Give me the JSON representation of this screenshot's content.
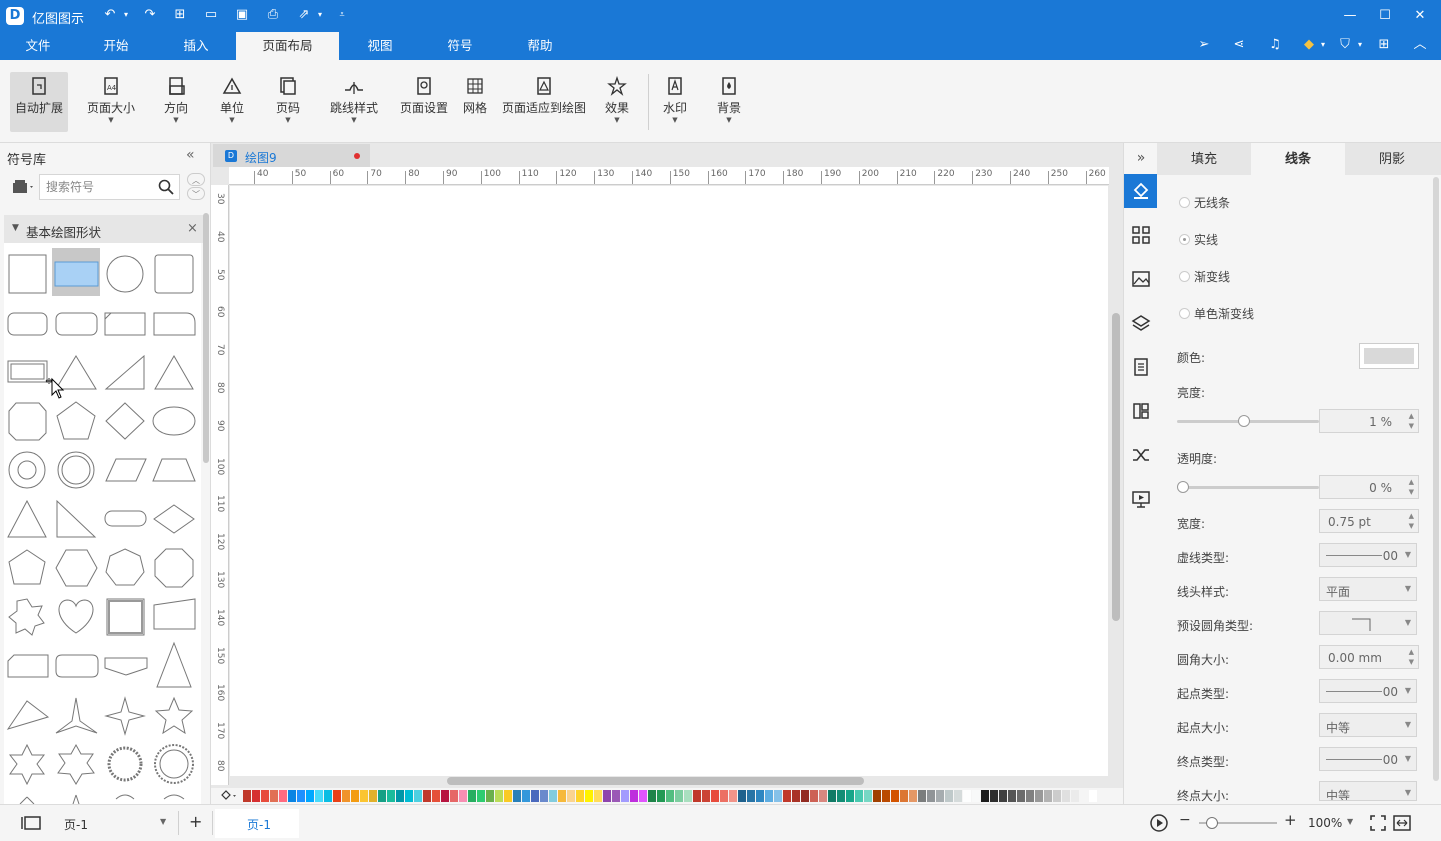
{
  "app": {
    "name": "亿图图示",
    "brand_color": "#1a78d6"
  },
  "menu": {
    "items": [
      "文件",
      "开始",
      "插入",
      "页面布局",
      "视图",
      "符号",
      "帮助"
    ],
    "active_index": 3
  },
  "ribbon": {
    "auto_extend": "自动扩展",
    "page_size": "页面大小",
    "orientation": "方向",
    "unit": "单位",
    "page_number": "页码",
    "jump_line_style": "跳线样式",
    "page_setup": "页面设置",
    "grid": "网格",
    "fit_page": "页面适应到绘图",
    "effects": "效果",
    "watermark": "水印",
    "background": "背景"
  },
  "library": {
    "title": "符号库",
    "search_placeholder": "搜索符号",
    "category": "基本绘图形状"
  },
  "document": {
    "tab_title": "绘图9",
    "ruler_h": [
      "40",
      "50",
      "60",
      "70",
      "80",
      "90",
      "100",
      "110",
      "120",
      "130",
      "140",
      "150",
      "160",
      "170",
      "180",
      "190",
      "200",
      "210",
      "220",
      "230",
      "240",
      "250",
      "260"
    ],
    "ruler_v": [
      "30",
      "40",
      "50",
      "60",
      "70",
      "80",
      "90",
      "100",
      "110",
      "120",
      "130",
      "140",
      "150",
      "160",
      "170",
      "80"
    ]
  },
  "format_panel": {
    "tabs": [
      "填充",
      "线条",
      "阴影"
    ],
    "active_tab": 1,
    "line_options": [
      "无线条",
      "实线",
      "渐变线",
      "单色渐变线"
    ],
    "selected_option": 1,
    "color_label": "颜色:",
    "brightness_label": "亮度:",
    "brightness_value": "1 %",
    "brightness_level": 0.47,
    "transparency_label": "透明度:",
    "transparency_value": "0 %",
    "transparency_level": 0,
    "width_label": "宽度:",
    "width_value": "0.75 pt",
    "dash_label": "虚线类型:",
    "dash_value": "00",
    "cap_label": "线头样式:",
    "cap_value": "平面",
    "corner_type_label": "预设圆角类型:",
    "corner_size_label": "圆角大小:",
    "corner_size_value": "0.00 mm",
    "start_type_label": "起点类型:",
    "start_type_value": "00",
    "start_size_label": "起点大小:",
    "start_size_value": "中等",
    "end_type_label": "终点类型:",
    "end_type_value": "00",
    "end_size_label": "终点大小:",
    "end_size_value": "中等"
  },
  "status": {
    "page_select": "页-1",
    "page_tab": "页-1",
    "zoom": "100%",
    "zoom_level": 0.1
  },
  "palette": [
    "#c0392b",
    "#d63031",
    "#e74c3c",
    "#e17055",
    "#ff6b81",
    "#0984e3",
    "#1e90ff",
    "#00a8ff",
    "#48dbfb",
    "#0abde3",
    "#e84118",
    "#f0932b",
    "#f39c12",
    "#fbc531",
    "#e1b12c",
    "#16a085",
    "#1abc9c",
    "#0097a7",
    "#00bcd4",
    "#4dd0e1",
    "#c0392b",
    "#e55039",
    "#b71540",
    "#e66767",
    "#f78fb3",
    "#27ae60",
    "#2ecc71",
    "#6ab04c",
    "#badc58",
    "#f9ca24",
    "#2980b9",
    "#3498db",
    "#4a69bd",
    "#6a89cc",
    "#82ccdd",
    "#f6b93b",
    "#fad390",
    "#ffd32a",
    "#fff200",
    "#ffdd59",
    "#8e44ad",
    "#9b59b6",
    "#a29bfe",
    "#be2edd",
    "#e056fd",
    "#1e8449",
    "#229954",
    "#52be80",
    "#7dcea0",
    "#a9dfbf",
    "#c0392b",
    "#cb4335",
    "#e74c3c",
    "#ec7063",
    "#f1948a",
    "#1f618d",
    "#2874a6",
    "#2e86c1",
    "#5dade2",
    "#85c1e9",
    "#c0392b",
    "#a93226",
    "#922b21",
    "#cd6155",
    "#d98880",
    "#117a65",
    "#138d75",
    "#17a589",
    "#48c9b0",
    "#76d7c4",
    "#a04000",
    "#ba4a00",
    "#d35400",
    "#dc7633",
    "#e59866",
    "#7b7d7d",
    "#909497",
    "#a6acaf",
    "#bfc9ca",
    "#d5dbdb",
    "#fdfefe",
    "#f8f9f9",
    "#1c1c1c",
    "#2e2e2e",
    "#404040",
    "#555555",
    "#6b6b6b",
    "#808080",
    "#999999",
    "#b3b3b3",
    "#cccccc",
    "#e0e0e0",
    "#ebebeb",
    "#f5f5f5",
    "#ffffff"
  ]
}
